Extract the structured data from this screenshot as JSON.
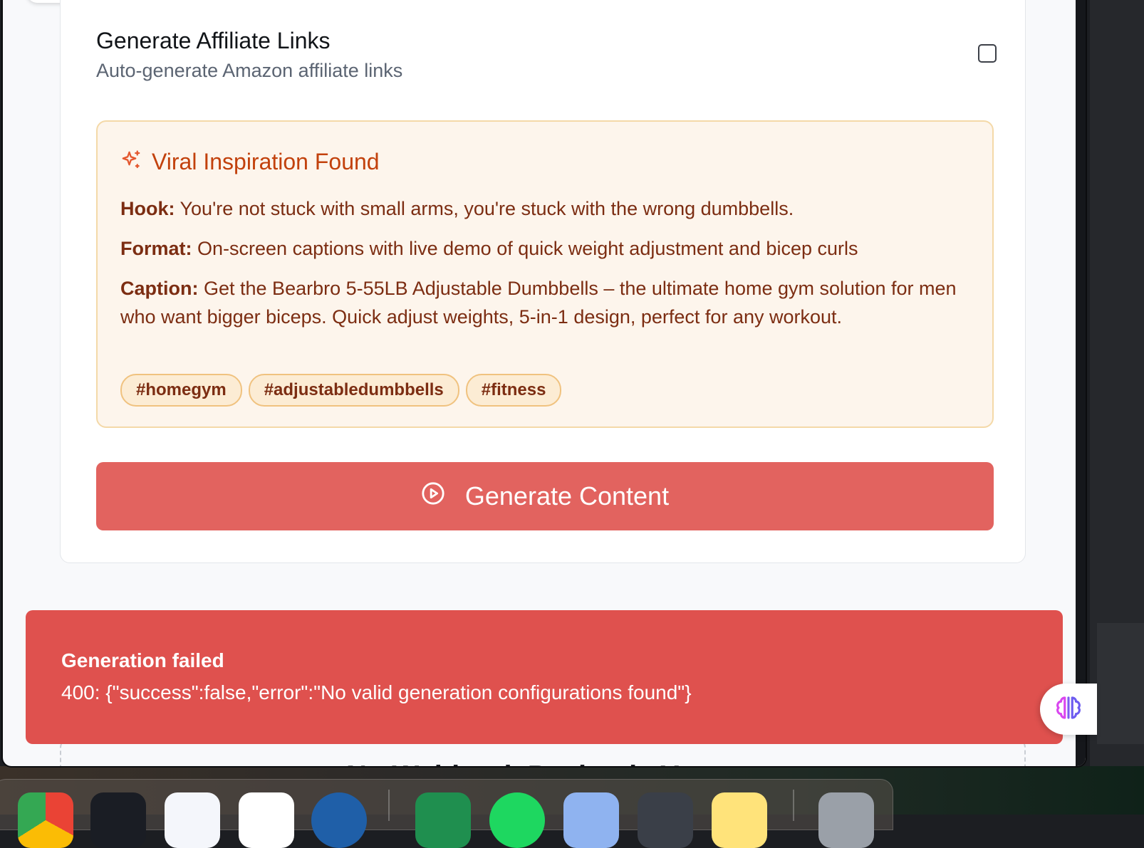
{
  "settings": {
    "affiliate_title": "Generate Affiliate Links",
    "affiliate_description": "Auto-generate Amazon affiliate links",
    "affiliate_checked": false
  },
  "inspiration": {
    "title": "Viral Inspiration Found",
    "icon": "sparkles-icon",
    "hook_label": "Hook:",
    "hook_text": "You're not stuck with small arms, you're stuck with the wrong dumbbells.",
    "format_label": "Format:",
    "format_text": "On-screen captions with live demo of quick weight adjustment and bicep curls",
    "caption_label": "Caption:",
    "caption_text": "Get the Bearbro 5-55LB Adjustable Dumbbells – the ultimate home gym solution for men who want bigger biceps. Quick adjust weights, 5-in-1 design, perfect for any workout.",
    "tags": [
      "#homegym",
      "#adjustabledumbbells",
      "#fitness"
    ]
  },
  "generate_button": {
    "label": "Generate Content",
    "icon": "play-circle-icon"
  },
  "empty_state": {
    "partial_text": "No Webhook Payloads Yet"
  },
  "toast": {
    "title": "Generation failed",
    "message": "400: {\"success\":false,\"error\":\"No valid generation configurations found\"}"
  },
  "widget": {
    "icon": "brain-icon"
  },
  "colors": {
    "accent_button": "#e2635f",
    "toast_bg": "#df514e",
    "inspiration_bg": "#fdf5ec",
    "inspiration_border": "#f4d9a8",
    "inspiration_text": "#7c2d12",
    "inspiration_title": "#c2410c"
  }
}
